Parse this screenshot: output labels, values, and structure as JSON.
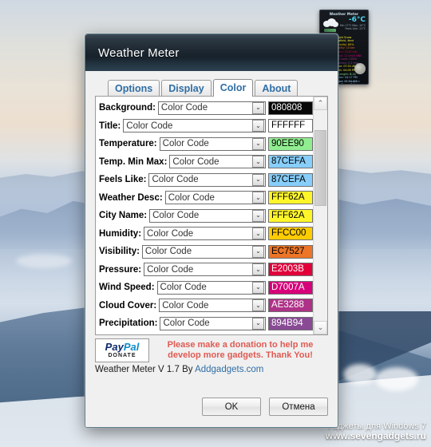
{
  "desktop": {
    "watermark_line1": "Гаджеты для Windows 7",
    "watermark_line2": "www.sevengadgets.ru"
  },
  "gadget": {
    "title": "Weather Meter",
    "temperature": "-6°C",
    "sub_line1": "Min 17°C Max -10°C",
    "sub_line2": "Feels Like -11°C",
    "desc": "Light Snow",
    "city": "Lingfield, Kent",
    "rows": [
      {
        "text": "Humidity: 85%",
        "color": "#FFCC00"
      },
      {
        "text": "Visibility: 10 km",
        "color": "#EC7527"
      },
      {
        "text": "Pressure: 1010 mb",
        "color": "#E2003B"
      },
      {
        "text": "Wind Speed: 11 km/h NNE",
        "color": "#D7007A"
      },
      {
        "text": "Cloud Cover: 100%",
        "color": "#AE3288"
      },
      {
        "text": "Precipitation: 0.2 mm",
        "color": "#894B94"
      },
      {
        "text": "Sunrise: 07:51 AM",
        "color": "#FFF62A"
      },
      {
        "text": "Sunset: 04:05 PM",
        "color": "#FFF62A"
      },
      {
        "text": "Day Length: 8:14",
        "color": "#90EE90"
      },
      {
        "text": "Moonrise: 04:17 PM",
        "color": "#87CEFA"
      },
      {
        "text": "Moonset: 07:54 AM",
        "color": "#87CEFA"
      },
      {
        "text": "Moon Phase: Full",
        "color": "#87CEFA"
      }
    ],
    "footer": "Last Update: 08:17:41 AM"
  },
  "dialog": {
    "title": "Weather Meter",
    "tabs": [
      {
        "label": "Options",
        "active": false
      },
      {
        "label": "Display",
        "active": false
      },
      {
        "label": "Color",
        "active": true
      },
      {
        "label": "About",
        "active": false
      }
    ],
    "combo_value": "Color Code",
    "rows": [
      {
        "label": "Background:",
        "mode": "Color Code",
        "code": "080808",
        "bg": "#080808",
        "fg": "#FFFFFF"
      },
      {
        "label": "Title:",
        "mode": "Color Code",
        "code": "FFFFFF",
        "bg": "#FFFFFF",
        "fg": "#000000"
      },
      {
        "label": "Temperature:",
        "mode": "Color Code",
        "code": "90EE90",
        "bg": "#90EE90",
        "fg": "#000000"
      },
      {
        "label": "Temp. Min Max:",
        "mode": "Color Code",
        "code": "87CEFA",
        "bg": "#87CEFA",
        "fg": "#000000"
      },
      {
        "label": "Feels Like:",
        "mode": "Color Code",
        "code": "87CEFA",
        "bg": "#87CEFA",
        "fg": "#000000"
      },
      {
        "label": "Weather Desc:",
        "mode": "Color Code",
        "code": "FFF62A",
        "bg": "#FFF62A",
        "fg": "#000000"
      },
      {
        "label": "City Name:",
        "mode": "Color Code",
        "code": "FFF62A",
        "bg": "#FFF62A",
        "fg": "#000000"
      },
      {
        "label": "Humidity:",
        "mode": "Color Code",
        "code": "FFCC00",
        "bg": "#FFCC00",
        "fg": "#000000"
      },
      {
        "label": "Visibility:",
        "mode": "Color Code",
        "code": "EC7527",
        "bg": "#EC7527",
        "fg": "#000000"
      },
      {
        "label": "Pressure:",
        "mode": "Color Code",
        "code": "E2003B",
        "bg": "#E2003B",
        "fg": "#FFFFFF"
      },
      {
        "label": "Wind Speed:",
        "mode": "Color Code",
        "code": "D7007A",
        "bg": "#D7007A",
        "fg": "#FFFFFF"
      },
      {
        "label": "Cloud Cover:",
        "mode": "Color Code",
        "code": "AE3288",
        "bg": "#AE3288",
        "fg": "#FFFFFF"
      },
      {
        "label": "Precipitation:",
        "mode": "Color Code",
        "code": "894B94",
        "bg": "#894B94",
        "fg": "#FFFFFF"
      }
    ],
    "scroll_up_icon": "⌃",
    "scroll_down_icon": "⌄",
    "combo_arrow_icon": "⌄",
    "paypal": {
      "brand_pay": "Pay",
      "brand_pal": "Pal",
      "donate_label": "DONATE"
    },
    "donation_line1": "Please make a donation to help me",
    "donation_line2": "develop more gadgets. Thank You!",
    "footer_text": "Weather Meter V 1.7 By ",
    "footer_link": "Addgadgets.com",
    "ok_label": "OK",
    "cancel_label": "Отмена"
  }
}
